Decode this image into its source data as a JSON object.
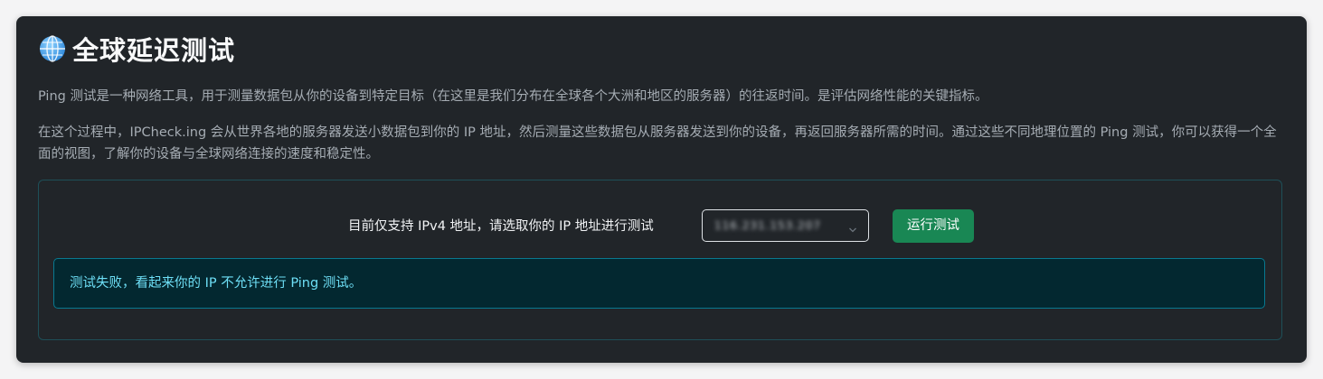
{
  "header": {
    "icon": "globe-icon",
    "title": "全球延迟测试"
  },
  "description": {
    "paragraph1": "Ping 测试是一种网络工具，用于测量数据包从你的设备到特定目标（在这里是我们分布在全球各个大洲和地区的服务器）的往返时间。是评估网络性能的关键指标。",
    "paragraph2": "在这个过程中，IPCheck.ing 会从世界各地的服务器发送小数据包到你的 IP 地址，然后测量这些数据包从服务器发送到你的设备，再返回服务器所需的时间。通过这些不同地理位置的 Ping 测试，你可以获得一个全面的视图，了解你的设备与全球网络连接的速度和稳定性。"
  },
  "controls": {
    "support_label": "目前仅支持 IPv4 地址，请选取你的 IP 地址进行测试",
    "ip_select": {
      "value": "116.231.153.207"
    },
    "run_button_label": "运行测试"
  },
  "alert": {
    "text": "测试失败，看起来你的 IP 不允许进行 Ping 测试。"
  },
  "colors": {
    "background": "#212529",
    "run_button": "#198754",
    "alert_bg": "#032830",
    "alert_border": "#087990",
    "alert_text": "#6edff6"
  }
}
